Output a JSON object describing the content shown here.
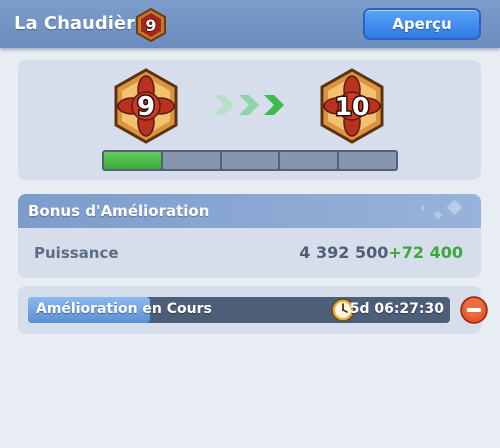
{
  "header": {
    "title": "La Chaudière",
    "level_badge": "9",
    "preview_label": "Aperçu"
  },
  "level": {
    "current": "9",
    "next": "10",
    "progress_segments_total": 5,
    "progress_segments_filled": 1
  },
  "bonus": {
    "title": "Bonus d'Amélioration",
    "stat_label": "Puissance",
    "stat_value": "4 392 500",
    "stat_bonus": "+72 400"
  },
  "upgrade": {
    "label": "Amélioration en Cours",
    "time_remaining": "5d 06:27:30",
    "progress_fraction": 0.29
  },
  "colors": {
    "header": "#6b8cbd",
    "accent_green": "#3ea83c",
    "button_blue": "#2f7be3",
    "cancel_orange": "#e8562a"
  }
}
